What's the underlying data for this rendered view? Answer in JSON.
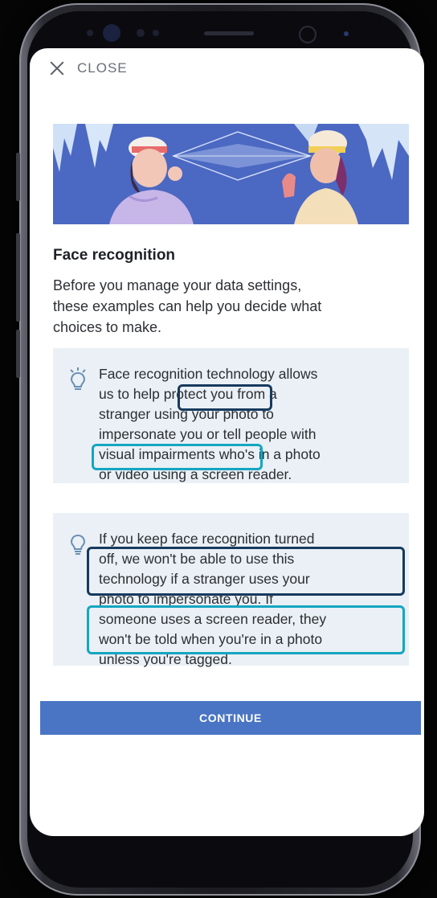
{
  "header": {
    "close_label": "CLOSE"
  },
  "page": {
    "title": "Face recognition",
    "intro_lines": [
      "Before you manage your data settings,",
      "these examples can help you decide what",
      "choices to make."
    ]
  },
  "cards": [
    {
      "lines": [
        "Face recognition technology allows",
        "us to help protect you from a",
        "stranger using your photo to",
        "impersonate you or tell people with",
        "visual impairments who's in a photo",
        "or video using a screen reader."
      ]
    },
    {
      "lines": [
        "If you keep face recognition turned",
        "off, we won't be able to use this",
        "technology if a stranger uses your",
        "photo to impersonate you. If",
        "someone uses a screen reader, they",
        "won't be told when you're in a photo",
        "unless you're tagged."
      ]
    }
  ],
  "footer": {
    "continue_label": "CONTINUE"
  },
  "colors": {
    "accent": "#4a75c4",
    "highlight_dark": "#173a5e",
    "highlight_teal": "#14a6c2"
  }
}
